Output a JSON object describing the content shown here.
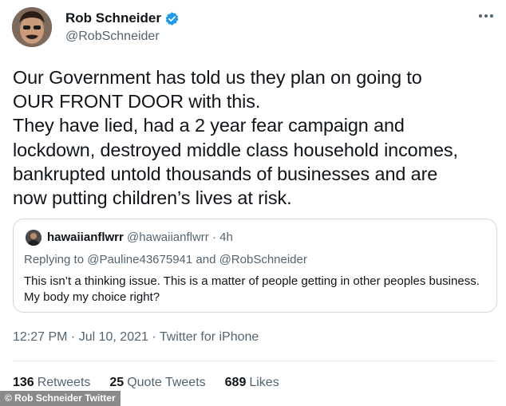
{
  "author": {
    "name": "Rob Schneider",
    "handle": "@RobSchneider",
    "verified_icon": "verified-badge-icon",
    "verified_color": "#1d9bf0"
  },
  "tweet": {
    "lines": [
      "Our Government has told us they plan on going to",
      "OUR FRONT DOOR with this.",
      "They have lied, had a 2 year fear campaign and",
      "lockdown, destroyed middle class household incomes,",
      "bankrupted untold thousands of businesses and are",
      "now putting children’s lives at risk."
    ]
  },
  "quote": {
    "name": "hawaiianflwrr",
    "handle_time": "@hawaiianflwrr · 4h",
    "reply": "Replying to @Pauline43675941 and @RobSchneider",
    "body": "This isn’t a thinking issue. This is a matter of people getting in other peoples business. My body my choice right?"
  },
  "meta": {
    "timestamp": "12:27 PM · Jul 10, 2021 · Twitter for iPhone"
  },
  "stats": {
    "retweets_count": "136",
    "retweets_label": "Retweets",
    "quotes_count": "25",
    "quotes_label": "Quote Tweets",
    "likes_count": "689",
    "likes_label": "Likes"
  },
  "credit": "© Rob Schneider Twitter"
}
